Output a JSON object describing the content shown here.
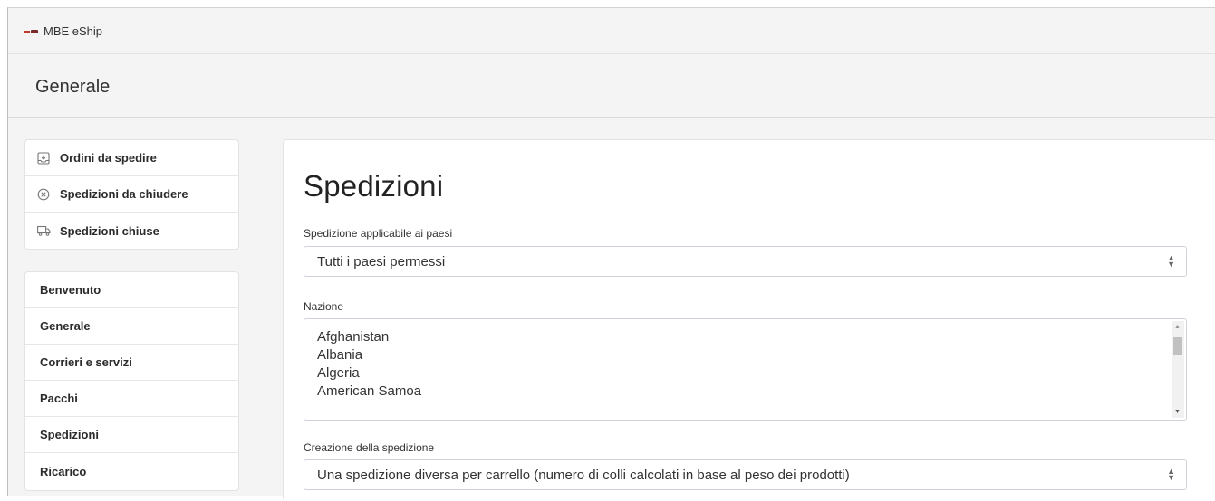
{
  "app": {
    "title": "MBE eShip"
  },
  "header": {
    "title": "Generale"
  },
  "sidebar_top": {
    "items": [
      {
        "label": "Ordini da spedire",
        "icon": "inbox-download-icon"
      },
      {
        "label": "Spedizioni da chiudere",
        "icon": "circle-x-icon"
      },
      {
        "label": "Spedizioni chiuse",
        "icon": "truck-icon"
      }
    ]
  },
  "sidebar_menu": {
    "items": [
      {
        "label": "Benvenuto"
      },
      {
        "label": "Generale"
      },
      {
        "label": "Corrieri e servizi"
      },
      {
        "label": "Pacchi"
      },
      {
        "label": "Spedizioni"
      },
      {
        "label": "Ricarico"
      }
    ]
  },
  "main": {
    "title": "Spedizioni",
    "countries_applicable": {
      "label": "Spedizione applicabile ai paesi",
      "value": "Tutti i paesi permessi"
    },
    "nation": {
      "label": "Nazione",
      "options": [
        "Afghanistan",
        "Albania",
        "Algeria",
        "American Samoa"
      ]
    },
    "shipment_creation": {
      "label": "Creazione della spedizione",
      "value": "Una spedizione diversa per carrello (numero di colli calcolati in base al peso dei prodotti)"
    }
  }
}
